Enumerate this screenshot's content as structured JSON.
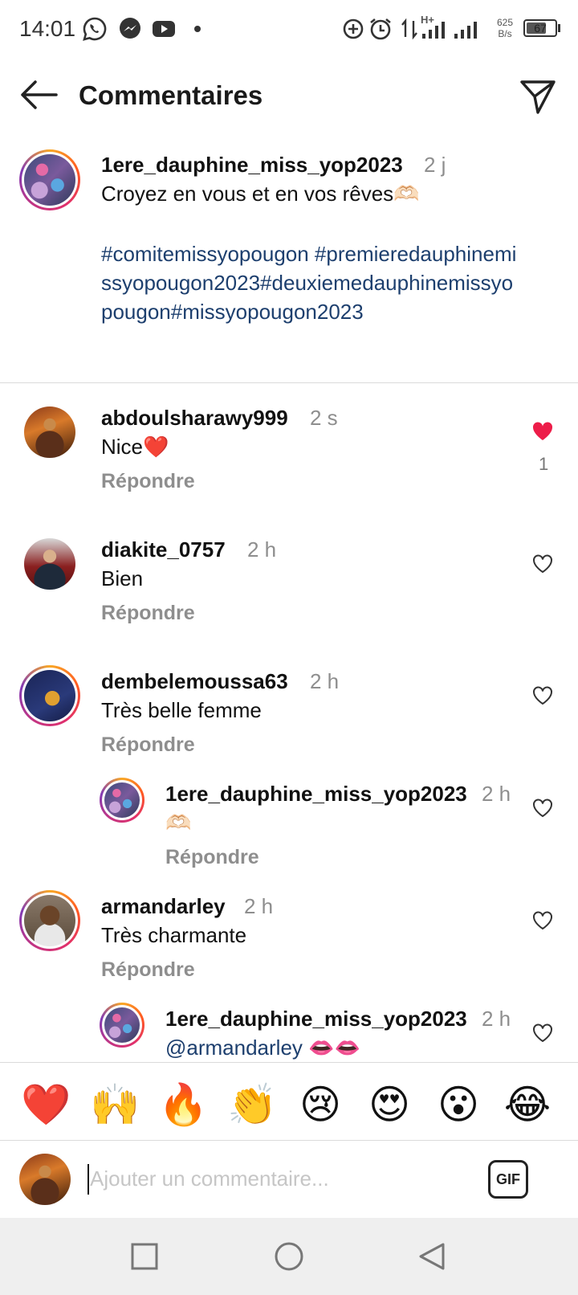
{
  "status_bar": {
    "time": "14:01",
    "network_speed_value": "625",
    "network_speed_unit": "B/s",
    "battery": "67",
    "network_type": "H+",
    "icons": [
      "whatsapp-icon",
      "messenger-icon",
      "youtube-icon",
      "dot-icon",
      "data-saver-icon",
      "alarm-icon",
      "data-transfer-icon",
      "signal-icon",
      "signal-icon",
      "battery-icon"
    ]
  },
  "header": {
    "title": "Commentaires",
    "back_icon": "arrow-left-icon",
    "send_icon": "paper-plane-icon"
  },
  "caption": {
    "username": "1ere_dauphine_miss_yop2023",
    "time": "2 j",
    "text": "Croyez en vous et en vos rêves🫶🏻",
    "hashtags": "#comitemissyopougon #premieredauphinemissyopougon2023#deuxiemedauphinemissyopougon#missyopougon2023"
  },
  "comments": [
    {
      "username": "abdoulsharawy999",
      "time": "2 s",
      "text": "Nice❤️",
      "reply_label": "Répondre",
      "liked": true,
      "like_count": "1"
    },
    {
      "username": "diakite_0757",
      "time": "2 h",
      "text": "Bien",
      "reply_label": "Répondre",
      "liked": false
    },
    {
      "username": "dembelemoussa63",
      "time": "2 h",
      "text": "Très belle femme",
      "reply_label": "Répondre",
      "liked": false
    },
    {
      "username": "1ere_dauphine_miss_yop2023",
      "time": "2 h",
      "text": "🫶🏻",
      "reply_label": "Répondre",
      "liked": false
    },
    {
      "username": "armandarley",
      "time": "2 h",
      "text": "Très charmante",
      "reply_label": "Répondre",
      "liked": false
    },
    {
      "username": "1ere_dauphine_miss_yop2023",
      "time": "2 h",
      "mention": "@armandarley",
      "text_rest": " 👄👄",
      "liked": false
    }
  ],
  "emoji_bar": [
    "❤️",
    "🙌",
    "🔥",
    "👏",
    "😢",
    "😍",
    "😮",
    "😂"
  ],
  "input": {
    "placeholder": "Ajouter un commentaire...",
    "gif_label": "GIF"
  },
  "nav_bar": [
    "square-icon",
    "circle-icon",
    "triangle-back-icon"
  ],
  "colors": {
    "hashtag": "#1d3f6e",
    "secondary_text": "#8e8e8e",
    "like_red": "#ed1d49",
    "divider": "#dbdbdb"
  }
}
